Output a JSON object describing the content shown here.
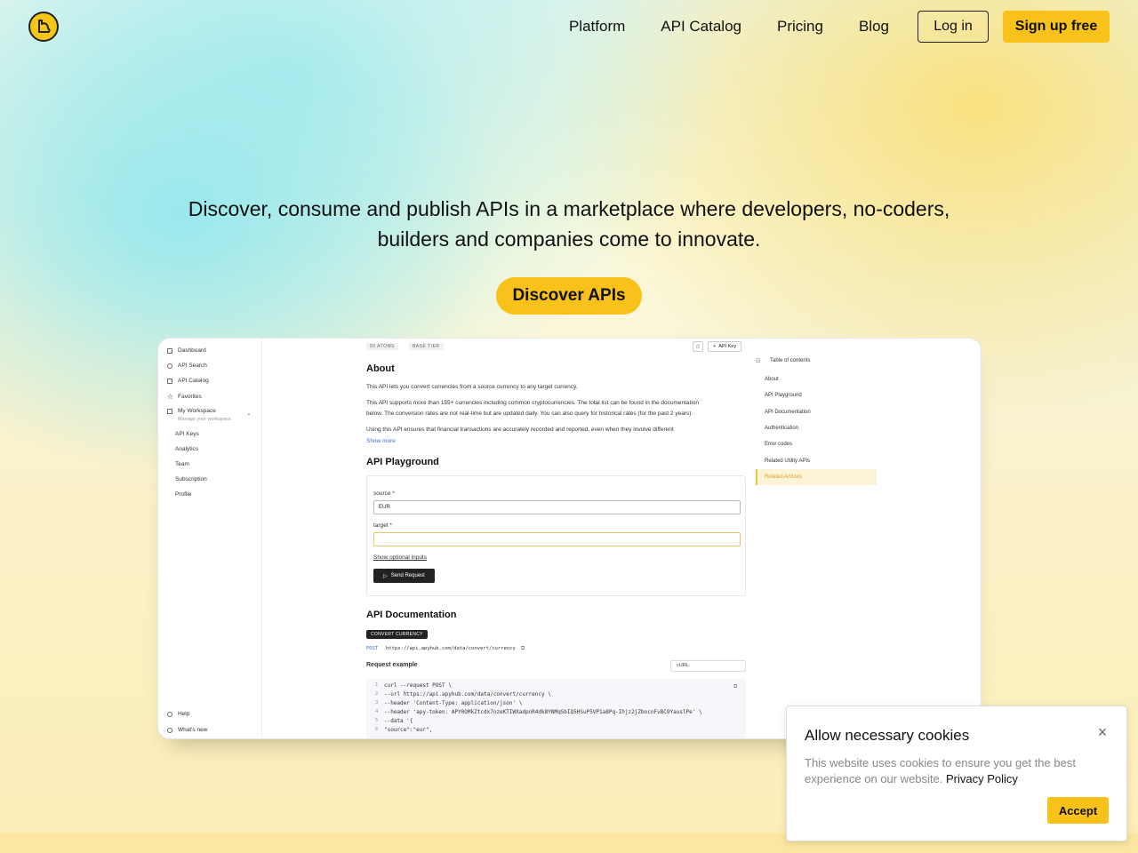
{
  "nav": {
    "links": [
      "Platform",
      "API Catalog",
      "Pricing",
      "Blog"
    ],
    "login_label": "Log in",
    "signup_label": "Sign up free"
  },
  "hero": {
    "line1": "Discover, consume and publish APIs in a marketplace where developers, no-coders,",
    "line2": "builders and companies come to innovate.",
    "cta_label": "Discover APIs"
  },
  "preview": {
    "sidebar": {
      "items": [
        "Dashboard",
        "API Search",
        "API Catalog",
        "Favorites",
        "My Workspace"
      ],
      "workspace_sub": "Manage your workspace",
      "sub_items": [
        "API Keys",
        "Analytics",
        "Team",
        "Subscription",
        "Profile"
      ],
      "help": "Help",
      "whats_new": "What's new"
    },
    "pills": [
      "50 ATOMS",
      "BASE TIER"
    ],
    "api_key_label": "API Key",
    "about": {
      "heading": "About",
      "p1": "This API lets you convert currencies from a source currency to any target currency.",
      "p2a": "This API supports more than 155+ currencies including common cryptocurrencies. The total list can be found in the documentation",
      "p2b": "below. The conversion rates are not real-time but are updated daily. You can also query for historical rates (for the past 2 years).",
      "p3": "Using this API ensures that financial transactions are accurately recorded and reported, even when they involve different",
      "show_more": "Show more"
    },
    "playground": {
      "heading": "API Playground",
      "source_label": "source *",
      "source_value": "EUR",
      "target_label": "target *",
      "optional_link": "Show optional inputs",
      "send_label": "Send Request"
    },
    "docs": {
      "heading": "API Documentation",
      "badge": "CONVERT CURRENCY",
      "method": "POST",
      "url": "https://api.apyhub.com/data/convert/currency",
      "request_example": "Request example",
      "lang": "cURL",
      "code": [
        {
          "n": "1",
          "t": "curl --request POST \\"
        },
        {
          "n": "2",
          "t": "  --url https://api.apyhub.com/data/convert/currency \\"
        },
        {
          "n": "3",
          "t": "  --header 'Content-Type: application/json' \\"
        },
        {
          "n": "4",
          "t": "  --header 'apy-token: APY0OMkZtcdx7nzeKTIWXadpnR4dk8YNMqSbIQ5HSuP5VP1a8Pq-Ihjz2jZbocnFvBC9YauslPe' \\"
        },
        {
          "n": "5",
          "t": "  --data '{"
        },
        {
          "n": "6",
          "t": "    \"source\":\"eur\","
        }
      ]
    },
    "toc": {
      "title": "Table of contents",
      "items": [
        "About",
        "API Playground",
        "API Documentation",
        "Authentication",
        "Error codes",
        "Related Utility APIs",
        "Related Articles"
      ]
    }
  },
  "cookie": {
    "title": "Allow necessary cookies",
    "text": "This website uses cookies to ensure you get the best experience on our website.",
    "link": "Privacy Policy",
    "accept_label": "Accept",
    "close_icon": "close-icon"
  }
}
